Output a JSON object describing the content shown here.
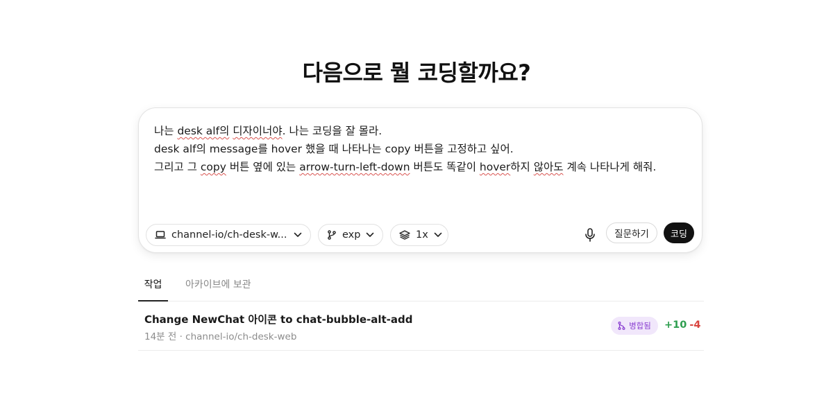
{
  "heading": "다음으로 뭘 코딩할까요?",
  "composer": {
    "prompt_lines": [
      [
        {
          "t": "나는 ",
          "sq": false
        },
        {
          "t": "desk alf의",
          "sq": true
        },
        {
          "t": " ",
          "sq": false
        },
        {
          "t": "디자이너야",
          "sq": true
        },
        {
          "t": ". 나는 코딩을 잘 몰라.",
          "sq": false
        }
      ],
      [
        {
          "t": "desk alf의 message를 hover 했을 때 나타나는 copy 버튼을 고정하고 싶어.",
          "sq": false
        }
      ],
      [
        {
          "t": "그리고 그 ",
          "sq": false
        },
        {
          "t": "copy",
          "sq": true
        },
        {
          "t": " 버튼 옆에 있는 ",
          "sq": false
        },
        {
          "t": "arrow-turn-left-down",
          "sq": true
        },
        {
          "t": " 버튼도 똑같이 ",
          "sq": false
        },
        {
          "t": "hover",
          "sq": true
        },
        {
          "t": "하지 ",
          "sq": false
        },
        {
          "t": "않아도",
          "sq": true
        },
        {
          "t": " 계속 나타나게 해줘.",
          "sq": false
        }
      ]
    ],
    "repo_chip": {
      "label": "channel-io/ch-desk-w...",
      "icon": "laptop-icon"
    },
    "branch_chip": {
      "label": "exp",
      "icon": "git-branch-icon"
    },
    "version_chip": {
      "label": "1x",
      "icon": "layers-icon"
    },
    "mic_icon": "microphone-icon",
    "ask_button": "질문하기",
    "code_button": "코딩"
  },
  "tabs": [
    {
      "label": "작업",
      "active": true
    },
    {
      "label": "아카이브에 보관",
      "active": false
    }
  ],
  "tasks": [
    {
      "title": "Change NewChat 아이콘 to chat-bubble-alt-add",
      "meta": "14분 전 · channel-io/ch-desk-web",
      "badge": "병합됨",
      "badge_icon": "git-merge-icon",
      "additions": "+10",
      "deletions": "-4"
    }
  ],
  "colors": {
    "merged_badge_bg": "#f1e7fb",
    "merged_badge_text": "#8a3fd1",
    "additions": "#2e9e4f",
    "deletions": "#d9443f",
    "primary_button": "#111111"
  }
}
